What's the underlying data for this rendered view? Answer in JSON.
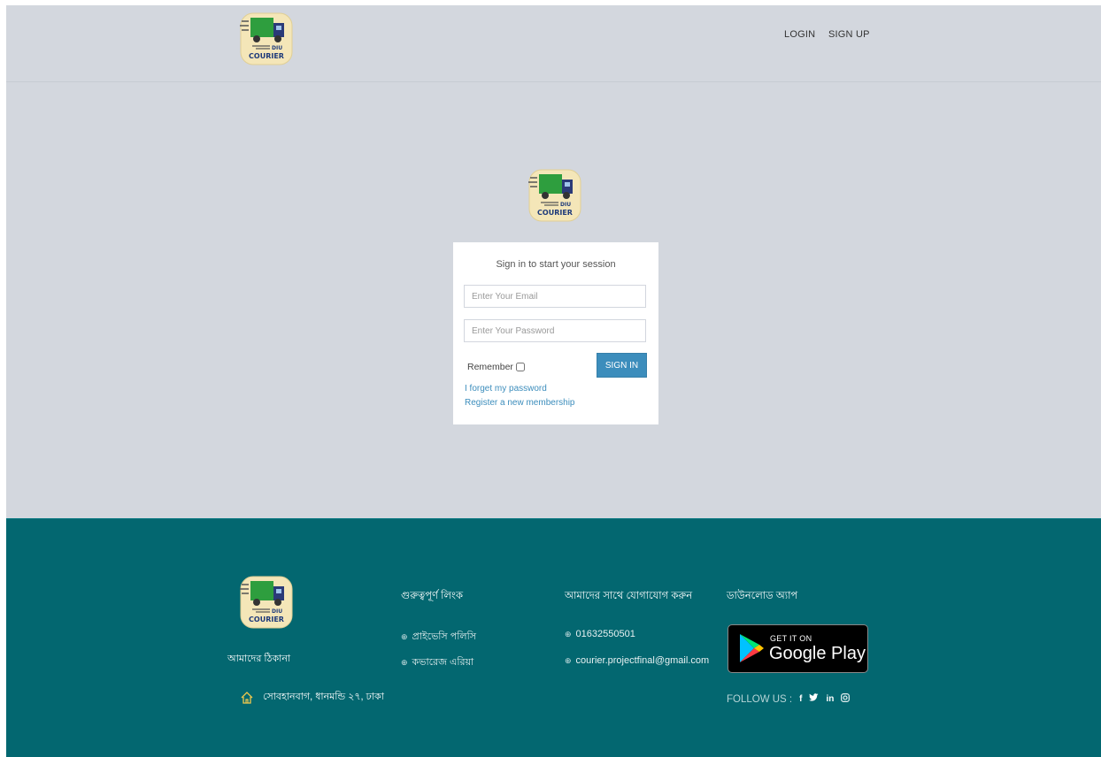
{
  "header": {
    "nav": {
      "login": "LOGIN",
      "signup": "SIGN UP"
    }
  },
  "login": {
    "message": "Sign in to start your session",
    "email_placeholder": "Enter Your Email",
    "password_placeholder": "Enter Your Password",
    "remember_label": "Remember",
    "signin_label": "SIGN IN",
    "forgot_link": "I forget my password",
    "register_link": "Register a new membership"
  },
  "logo": {
    "line1": "DIU",
    "line2": "COURIER"
  },
  "footer": {
    "address_title": "আমাদের ঠিকানা",
    "address": "সোবহানবাগ, ধানমন্ডি ২৭, ঢাকা",
    "links_title": "গুরুত্বপূর্ণ লিংক",
    "links": [
      "প্রাইভেসি পলিসি",
      "কভারেজ এরিয়া"
    ],
    "contact_title": "আমাদের সাথে যোগাযোগ করুন",
    "phone": "01632550501",
    "email": "courier.projectfinal@gmail.com",
    "download_title": "ডাউনলোড অ্যাপ",
    "store_badge": {
      "small": "GET IT ON",
      "big": "Google Play"
    },
    "follow_label": "FOLLOW US :",
    "social": [
      "f",
      "t",
      "in",
      "ig"
    ]
  },
  "colors": {
    "page_bg": "#d3d7de",
    "footer_bg": "#036770",
    "button": "#3c8dbc",
    "link": "#3c8dbc",
    "truck_body": "#2e9e3e"
  }
}
